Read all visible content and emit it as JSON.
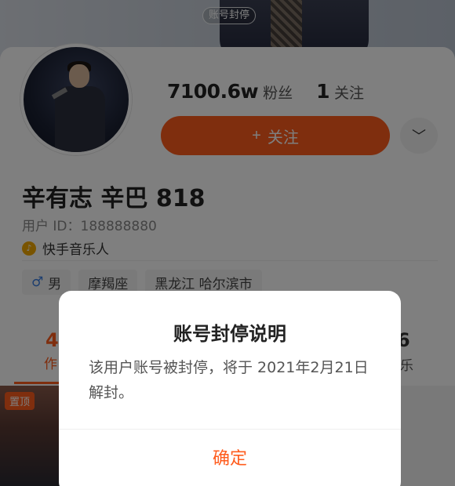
{
  "cover": {
    "banned_tag": "账号封停"
  },
  "profile": {
    "followers_count": "7100.6w",
    "followers_label": "粉丝",
    "following_count": "1",
    "following_label": "关注",
    "follow_button_icon": "+",
    "follow_button_label": "关注",
    "more_icon": "chevron-down-icon",
    "name": "辛有志 辛巴 818",
    "user_id": "用户 ID：188888880",
    "badge_label": "快手音乐人",
    "tags": [
      {
        "icon": "♂",
        "label": "男"
      },
      {
        "label": "摩羯座"
      },
      {
        "label": "黑龙江 哈尔滨市"
      }
    ]
  },
  "tabs_peek": {
    "left_number": "4",
    "left_label": "作",
    "right_number": "6",
    "right_label": "乐"
  },
  "grid": {
    "pinned_label": "置顶"
  },
  "modal": {
    "title": "账号封停说明",
    "body": "该用户账号被封停，将于 2021年2月21日解封。",
    "confirm_label": "确定"
  },
  "colors": {
    "accent": "#ff5c1d",
    "overlay": "rgba(0,0,0,0.5)"
  }
}
